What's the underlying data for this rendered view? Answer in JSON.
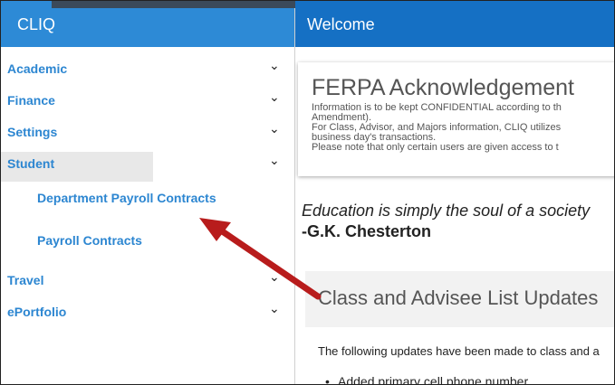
{
  "sidebar": {
    "brand": "CLIQ",
    "items": [
      {
        "label": "Academic"
      },
      {
        "label": "Finance"
      },
      {
        "label": "Settings"
      },
      {
        "label": "Student"
      },
      {
        "label": "Travel"
      },
      {
        "label": "ePortfolio"
      }
    ],
    "student_sub_items": [
      {
        "label": "Department Payroll Contracts"
      },
      {
        "label": "Payroll Contracts"
      }
    ]
  },
  "header": {
    "title": "Welcome"
  },
  "ferpa": {
    "title": "FERPA Acknowledgement",
    "body": "Information is to be kept CONFIDENTIAL according to th\nAmendment).\nFor Class, Advisor, and Majors information, CLIQ utilizes\nbusiness day's transactions.\nPlease note that only certain users are given access to t"
  },
  "quote": {
    "text": "Education is simply the soul of a society",
    "author": "-G.K. Chesterton"
  },
  "updates": {
    "title": "Class and Advisee List Updates",
    "intro": "The following updates have been made to class and a",
    "items": [
      "Added primary cell phone number"
    ]
  },
  "annotation": {
    "arrow_color": "#b81c1c"
  },
  "colors": {
    "sidebar_header": "#2d8ad6",
    "main_header": "#1570c4",
    "link": "#2c86d1"
  }
}
